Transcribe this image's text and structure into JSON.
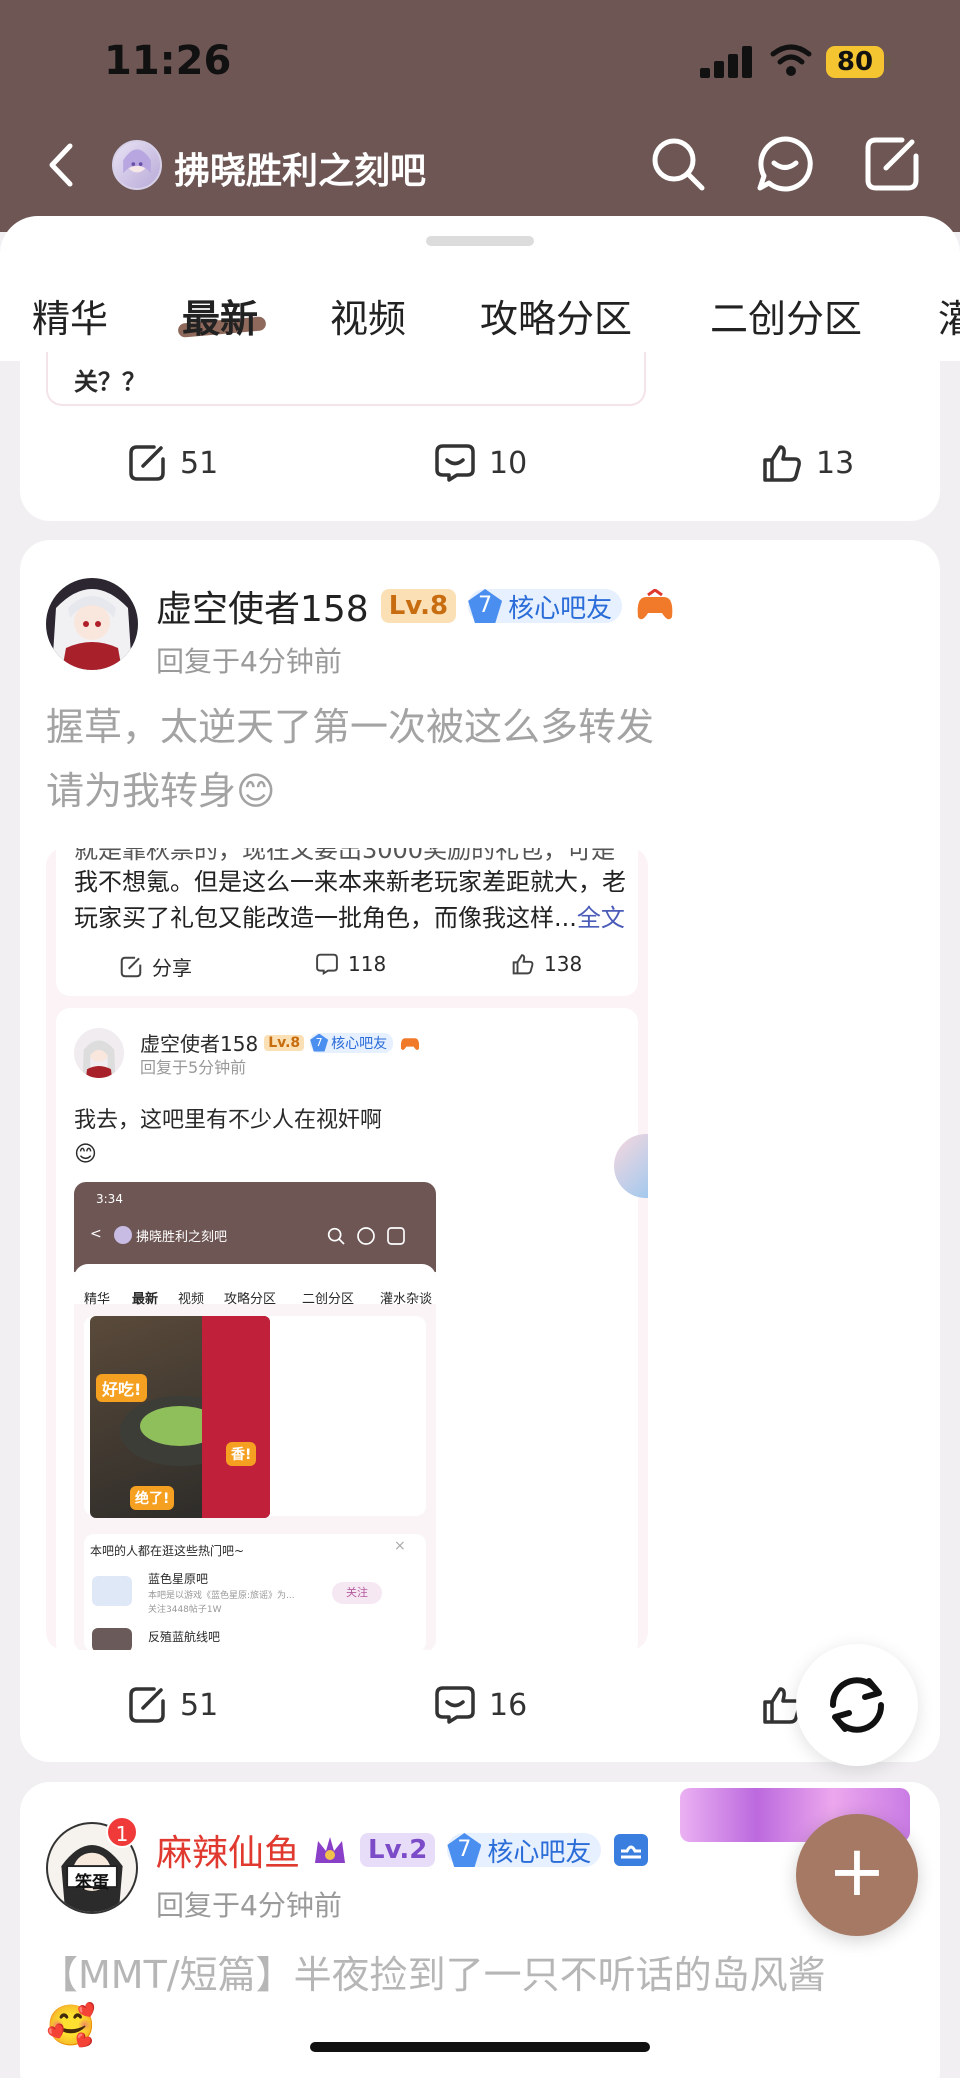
{
  "status_bar": {
    "time": "11:26",
    "battery": "80"
  },
  "nav": {
    "title": "拂晓胜利之刻吧"
  },
  "tabs": [
    "精华",
    "最新",
    "视频",
    "攻略分区",
    "二创分区",
    "灌"
  ],
  "active_tab": "最新",
  "post_prev": {
    "quote_tail": "关？？",
    "share_count": "51",
    "comment_count": "10",
    "like_count": "13"
  },
  "post1": {
    "username": "虚空使者158",
    "level": "Lv.8",
    "badge_num": "7",
    "badge_label": "核心吧友",
    "meta": "回复于4分钟前",
    "line1": "握草，太逆天了第一次被这么多转发",
    "line2": "请为我转身😊",
    "screenshot": {
      "text_line1": "就是靠秋票的，现在又要出3000奖励的礼包，可是",
      "text_line2": "我不想氪。但是这么一来本来新老玩家差距就大，老",
      "text_line3": "玩家买了礼包又能改造一批角色，而像我这样...",
      "more_link": "全文",
      "share_label": "分享",
      "comments": "118",
      "likes": "138",
      "inner_username": "虚空使者158",
      "inner_level": "Lv.8",
      "inner_badge_num": "7",
      "inner_badge": "核心吧友",
      "inner_meta": "回复于5分钟前",
      "inner_text": "我去，这吧里有不少人在视奸啊",
      "inner_emoji": "😊",
      "nested": {
        "time": "3:34",
        "title": "拂晓胜利之刻吧",
        "tabs": [
          "精华",
          "最新",
          "视频",
          "攻略分区",
          "二创分区",
          "灌水杂谈"
        ],
        "sticker_1": "好吃!",
        "sticker_2": "香!",
        "sticker_3": "绝了!",
        "hot_title": "本吧的人都在逛这些热门吧~",
        "hot_close": "×",
        "hot1_name": "蓝色星原吧",
        "hot1_desc": "本吧是以游戏《蓝色星原:旅谣》为...",
        "hot1_follow": "关注3448帖子1W",
        "hot1_button": "关注",
        "hot2_name": "反殖蓝航线吧"
      }
    },
    "share_count": "51",
    "comment_count": "16"
  },
  "post2": {
    "username": "麻辣仙鱼",
    "level": "Lv.2",
    "badge_num": "7",
    "badge_label": "核心吧友",
    "notif": "1",
    "avatar_text": "笨蛋",
    "meta": "回复于4分钟前",
    "title": "【MMT/短篇】半夜捡到了一只不听话的岛风酱",
    "emoji": "🥰"
  },
  "fab": {
    "plus": "+"
  },
  "colors": {
    "header": "#6d5654",
    "fab": "#a67964",
    "accent_red": "#e0392f",
    "level_orange": "#f7c46b"
  }
}
